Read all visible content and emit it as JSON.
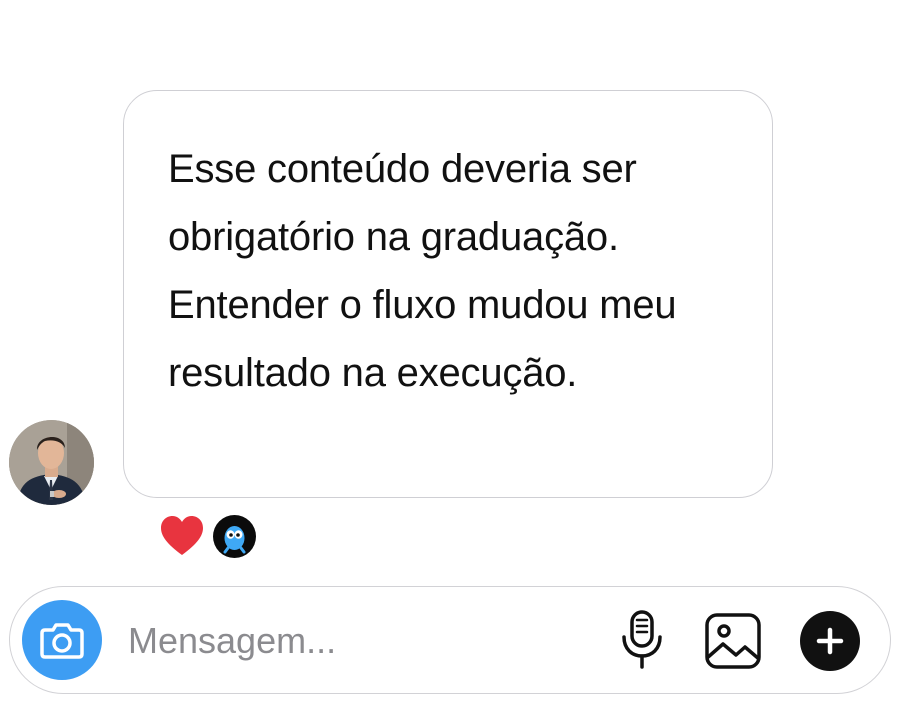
{
  "message": {
    "lines": [
      "Esse conteúdo deveria ser",
      "obrigatório na graduação.",
      "Entender o fluxo mudou meu",
      "resultado na execução."
    ]
  },
  "reactions": [
    {
      "icon": "heart-icon",
      "color": "#e8343f"
    },
    {
      "icon": "bot-emoji-icon",
      "color": "#3fa9f5"
    }
  ],
  "composer": {
    "placeholder": "Mensagem...",
    "value": "",
    "accent_color": "#3d9df3",
    "icons": [
      "camera-icon",
      "microphone-icon",
      "image-icon",
      "plus-icon"
    ]
  }
}
